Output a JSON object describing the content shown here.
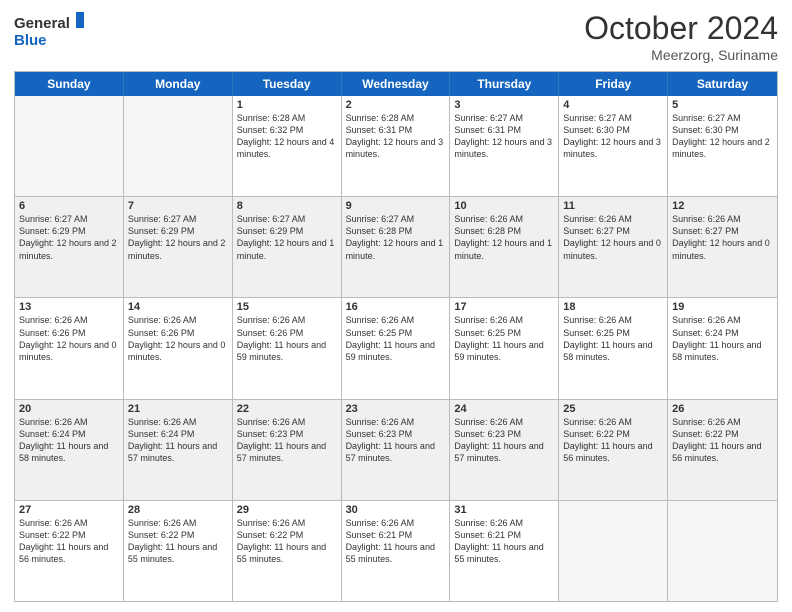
{
  "header": {
    "logo_line1": "General",
    "logo_line2": "Blue",
    "month": "October 2024",
    "location": "Meerzorg, Suriname"
  },
  "days_of_week": [
    "Sunday",
    "Monday",
    "Tuesday",
    "Wednesday",
    "Thursday",
    "Friday",
    "Saturday"
  ],
  "rows": [
    [
      {
        "day": "",
        "info": "",
        "empty": true
      },
      {
        "day": "",
        "info": "",
        "empty": true
      },
      {
        "day": "1",
        "info": "Sunrise: 6:28 AM\nSunset: 6:32 PM\nDaylight: 12 hours and 4 minutes."
      },
      {
        "day": "2",
        "info": "Sunrise: 6:28 AM\nSunset: 6:31 PM\nDaylight: 12 hours and 3 minutes."
      },
      {
        "day": "3",
        "info": "Sunrise: 6:27 AM\nSunset: 6:31 PM\nDaylight: 12 hours and 3 minutes."
      },
      {
        "day": "4",
        "info": "Sunrise: 6:27 AM\nSunset: 6:30 PM\nDaylight: 12 hours and 3 minutes."
      },
      {
        "day": "5",
        "info": "Sunrise: 6:27 AM\nSunset: 6:30 PM\nDaylight: 12 hours and 2 minutes."
      }
    ],
    [
      {
        "day": "6",
        "info": "Sunrise: 6:27 AM\nSunset: 6:29 PM\nDaylight: 12 hours and 2 minutes."
      },
      {
        "day": "7",
        "info": "Sunrise: 6:27 AM\nSunset: 6:29 PM\nDaylight: 12 hours and 2 minutes."
      },
      {
        "day": "8",
        "info": "Sunrise: 6:27 AM\nSunset: 6:29 PM\nDaylight: 12 hours and 1 minute."
      },
      {
        "day": "9",
        "info": "Sunrise: 6:27 AM\nSunset: 6:28 PM\nDaylight: 12 hours and 1 minute."
      },
      {
        "day": "10",
        "info": "Sunrise: 6:26 AM\nSunset: 6:28 PM\nDaylight: 12 hours and 1 minute."
      },
      {
        "day": "11",
        "info": "Sunrise: 6:26 AM\nSunset: 6:27 PM\nDaylight: 12 hours and 0 minutes."
      },
      {
        "day": "12",
        "info": "Sunrise: 6:26 AM\nSunset: 6:27 PM\nDaylight: 12 hours and 0 minutes."
      }
    ],
    [
      {
        "day": "13",
        "info": "Sunrise: 6:26 AM\nSunset: 6:26 PM\nDaylight: 12 hours and 0 minutes."
      },
      {
        "day": "14",
        "info": "Sunrise: 6:26 AM\nSunset: 6:26 PM\nDaylight: 12 hours and 0 minutes."
      },
      {
        "day": "15",
        "info": "Sunrise: 6:26 AM\nSunset: 6:26 PM\nDaylight: 11 hours and 59 minutes."
      },
      {
        "day": "16",
        "info": "Sunrise: 6:26 AM\nSunset: 6:25 PM\nDaylight: 11 hours and 59 minutes."
      },
      {
        "day": "17",
        "info": "Sunrise: 6:26 AM\nSunset: 6:25 PM\nDaylight: 11 hours and 59 minutes."
      },
      {
        "day": "18",
        "info": "Sunrise: 6:26 AM\nSunset: 6:25 PM\nDaylight: 11 hours and 58 minutes."
      },
      {
        "day": "19",
        "info": "Sunrise: 6:26 AM\nSunset: 6:24 PM\nDaylight: 11 hours and 58 minutes."
      }
    ],
    [
      {
        "day": "20",
        "info": "Sunrise: 6:26 AM\nSunset: 6:24 PM\nDaylight: 11 hours and 58 minutes."
      },
      {
        "day": "21",
        "info": "Sunrise: 6:26 AM\nSunset: 6:24 PM\nDaylight: 11 hours and 57 minutes."
      },
      {
        "day": "22",
        "info": "Sunrise: 6:26 AM\nSunset: 6:23 PM\nDaylight: 11 hours and 57 minutes."
      },
      {
        "day": "23",
        "info": "Sunrise: 6:26 AM\nSunset: 6:23 PM\nDaylight: 11 hours and 57 minutes."
      },
      {
        "day": "24",
        "info": "Sunrise: 6:26 AM\nSunset: 6:23 PM\nDaylight: 11 hours and 57 minutes."
      },
      {
        "day": "25",
        "info": "Sunrise: 6:26 AM\nSunset: 6:22 PM\nDaylight: 11 hours and 56 minutes."
      },
      {
        "day": "26",
        "info": "Sunrise: 6:26 AM\nSunset: 6:22 PM\nDaylight: 11 hours and 56 minutes."
      }
    ],
    [
      {
        "day": "27",
        "info": "Sunrise: 6:26 AM\nSunset: 6:22 PM\nDaylight: 11 hours and 56 minutes."
      },
      {
        "day": "28",
        "info": "Sunrise: 6:26 AM\nSunset: 6:22 PM\nDaylight: 11 hours and 55 minutes."
      },
      {
        "day": "29",
        "info": "Sunrise: 6:26 AM\nSunset: 6:22 PM\nDaylight: 11 hours and 55 minutes."
      },
      {
        "day": "30",
        "info": "Sunrise: 6:26 AM\nSunset: 6:21 PM\nDaylight: 11 hours and 55 minutes."
      },
      {
        "day": "31",
        "info": "Sunrise: 6:26 AM\nSunset: 6:21 PM\nDaylight: 11 hours and 55 minutes."
      },
      {
        "day": "",
        "info": "",
        "empty": true
      },
      {
        "day": "",
        "info": "",
        "empty": true
      }
    ]
  ]
}
